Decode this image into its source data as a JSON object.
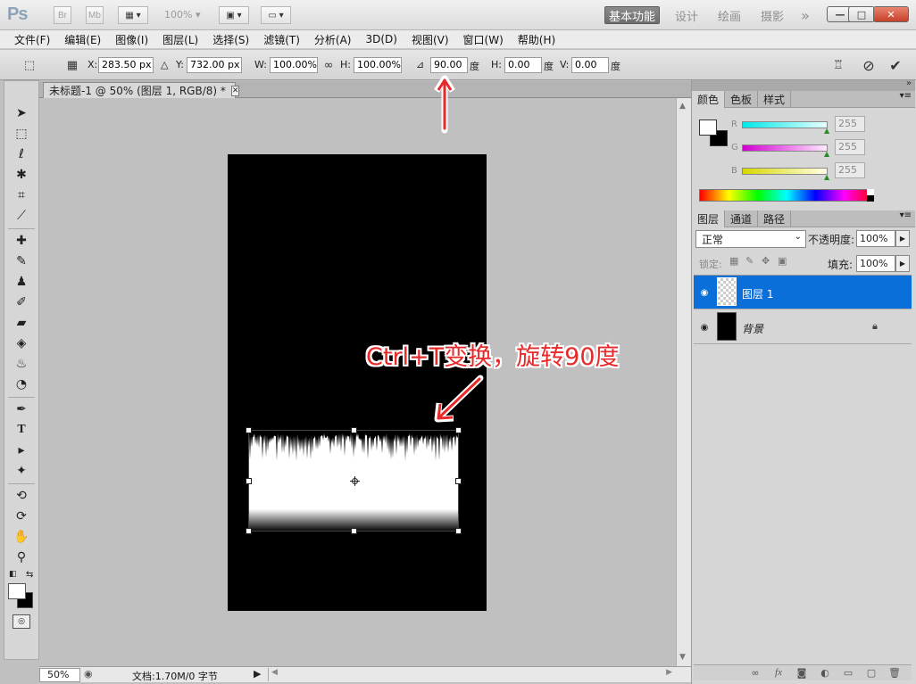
{
  "titlebar": {
    "logo": "Ps",
    "bridge_label": "Br",
    "minibridge_label": "Mb",
    "zoom_label": "100%",
    "workspaces": [
      {
        "label": "基本功能",
        "active": true
      },
      {
        "label": "设计",
        "active": false
      },
      {
        "label": "绘画",
        "active": false
      },
      {
        "label": "摄影",
        "active": false
      }
    ],
    "more": "»",
    "min": "—",
    "max": "□",
    "close": "✕"
  },
  "menu": {
    "items": [
      "文件(F)",
      "编辑(E)",
      "图像(I)",
      "图层(L)",
      "选择(S)",
      "滤镜(T)",
      "分析(A)",
      "3D(D)",
      "视图(V)",
      "窗口(W)",
      "帮助(H)"
    ]
  },
  "options": {
    "x_label": "X:",
    "x_value": "283.50 px",
    "y_label": "Y:",
    "y_value": "732.00 px",
    "w_label": "W:",
    "w_value": "100.00%",
    "h_label": "H:",
    "h_value": "100.00%",
    "angle_value": "90.00",
    "angle_unit": "度",
    "hskew_label": "H:",
    "hskew_value": "0.00",
    "hskew_unit": "度",
    "vskew_label": "V:",
    "vskew_value": "0.00",
    "vskew_unit": "度"
  },
  "document": {
    "tab_title": "未标题-1 @ 50% (图层 1, RGB/8) *",
    "close": "✕",
    "zoom": "50%",
    "doc_info": "文档:1.70M/0 字节",
    "annotation": "Ctrl+T变换，旋转90度"
  },
  "color_panel": {
    "tabs": [
      "颜色",
      "色板",
      "样式"
    ],
    "channels": [
      {
        "label": "R",
        "value": "255",
        "color": "#00e0e0"
      },
      {
        "label": "G",
        "value": "255",
        "color": "#e000e0"
      },
      {
        "label": "B",
        "value": "255",
        "color": "#e0e000"
      }
    ]
  },
  "layers_panel": {
    "tabs": [
      "图层",
      "通道",
      "路径"
    ],
    "blend_mode": "正常",
    "opacity_label": "不透明度:",
    "opacity_value": "100%",
    "lock_label": "锁定:",
    "fill_label": "填充:",
    "fill_value": "100%",
    "layers": [
      {
        "name": "图层 1",
        "selected": true
      },
      {
        "name": "背景",
        "selected": false
      }
    ],
    "bottom_buttons": [
      "link-icon",
      "fx-icon",
      "mask-icon",
      "adjustment-icon",
      "group-icon",
      "new-layer-icon",
      "trash-icon"
    ]
  },
  "colors": {
    "selection": "#2f76c9",
    "annotation": "#e62a2a"
  }
}
